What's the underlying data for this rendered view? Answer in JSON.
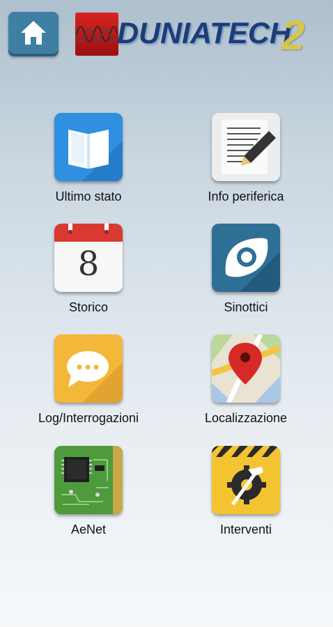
{
  "header": {
    "home_icon": "home-icon",
    "logo_text": "DUNIATECH",
    "logo_suffix": "2"
  },
  "tiles": [
    {
      "label": "Ultimo stato",
      "icon": "book-icon"
    },
    {
      "label": "Info periferica",
      "icon": "document-pen-icon"
    },
    {
      "label": "Storico",
      "icon": "calendar-icon",
      "calendar_day": "8"
    },
    {
      "label": "Sinottici",
      "icon": "eye-icon"
    },
    {
      "label": "Log/Interrogazioni",
      "icon": "chat-bubble-icon"
    },
    {
      "label": "Localizzazione",
      "icon": "map-pin-icon"
    },
    {
      "label": "AeNet",
      "icon": "circuit-board-icon"
    },
    {
      "label": "Interventi",
      "icon": "tools-icon"
    }
  ],
  "colors": {
    "home_button": "#3f7fa4",
    "book_tile": "#2f8fe0",
    "eye_tile": "#2e6f96",
    "chat_tile": "#f3b73a",
    "calendar_header": "#d83a32"
  }
}
